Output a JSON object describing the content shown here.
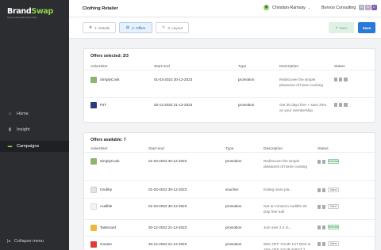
{
  "app": {
    "logo_brand": "Brand",
    "logo_swap": "Swap",
    "tagline": "Swap and Rewards Partnerships",
    "title": "Clothing Retailer"
  },
  "sidebar": {
    "items": [
      {
        "label": "Home",
        "icon": "home-icon"
      },
      {
        "label": "Insight",
        "icon": "bar-chart-icon"
      },
      {
        "label": "Campaigns",
        "icon": "folder-icon",
        "active": true
      }
    ],
    "collapse_label": "Collapse menu"
  },
  "header": {
    "user_name": "Christian Ramsay",
    "org_name": "Boroos Consulting",
    "org_badges": [
      "B",
      "A",
      "C"
    ]
  },
  "steps": [
    {
      "label": "1. Details",
      "icon": "move-icon"
    },
    {
      "label": "2. Offers",
      "icon": "globe-icon",
      "active": true
    },
    {
      "label": "3. Layout",
      "icon": "pencil-icon"
    }
  ],
  "actions": {
    "start_label": "Start",
    "save_label": "Save"
  },
  "colors": {
    "accent": "#2a79d4",
    "brand_green": "#8fd14f",
    "sidebar_bg": "#2b2d30",
    "selected_green": "#2a8b45"
  },
  "selected": {
    "title": "Offers selected: 3/3",
    "columns": [
      "Advertiser",
      "Start-end",
      "Type",
      "Description",
      "Status"
    ],
    "rows": [
      {
        "advertiser": "SimplyCook",
        "dates": "01-03-2022 30-12-2023",
        "type": "promotion",
        "desc": "Rediscover the simple pleasures of home cooking"
      },
      {
        "advertiser": "FIIT",
        "dates": "20-12-2022 21-12-2023",
        "type": "promotion",
        "desc": "Get 30 days free + save 25% on your membership"
      }
    ]
  },
  "available": {
    "title": "Offers available: 7",
    "columns": [
      "Advertiser",
      "Start-end",
      "Type",
      "Description",
      "Status"
    ],
    "rows": [
      {
        "advertiser": "SimplyCook",
        "dates": "01-03-2022 30-12-2023",
        "type": "promotion",
        "desc": "Rediscover the simple pleasures of home cooking",
        "toggle": "Selected"
      },
      {
        "advertiser": "Grubby",
        "dates": "01-03-2022 30-12-2023",
        "type": "voucher",
        "desc": "Eating more pla...",
        "toggle": "Select"
      },
      {
        "advertiser": "Audible",
        "dates": "01-03-2022 30-12-2023",
        "type": "promotion",
        "desc": "Get an Amazon Audible 30 Day free trail",
        "toggle": "Select"
      },
      {
        "advertiser": "Tastecard",
        "dates": "20-12-2022 21-12-2023",
        "type": "promotion",
        "desc": "Join over 2.4 m...",
        "toggle": "Selected"
      },
      {
        "advertiser": "Gousto",
        "dates": "20-12-2022 21-12-2023",
        "type": "promotion",
        "desc": "65% OFF YOUR 1ST BOX & 25% OFF YOUR FIRST 2",
        "toggle": "Select"
      }
    ]
  }
}
